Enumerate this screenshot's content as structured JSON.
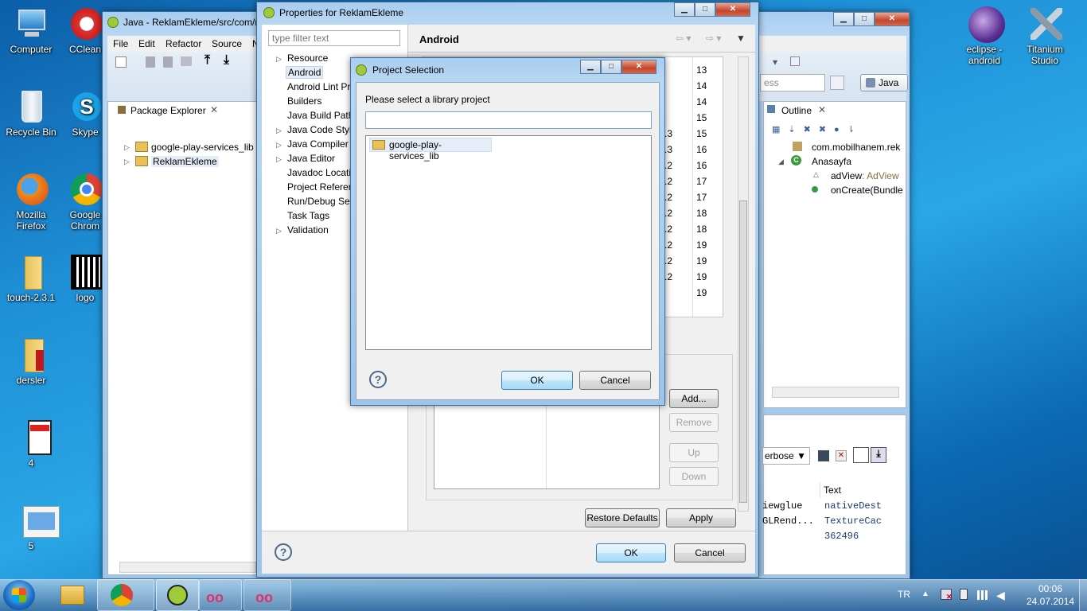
{
  "desktop": {
    "icons": [
      {
        "label": "Computer",
        "icon": "computer-icon"
      },
      {
        "label": "CClean",
        "icon": "ccleaner-icon"
      },
      {
        "label": "Recycle Bin",
        "icon": "recycle-bin-icon"
      },
      {
        "label": "Skype",
        "icon": "skype-icon"
      },
      {
        "label": "Mozilla Firefox",
        "icon": "firefox-icon"
      },
      {
        "label": "Google Chrom",
        "icon": "chrome-icon"
      },
      {
        "label": "touch-2.3.1",
        "icon": "folder-icon"
      },
      {
        "label": "logo",
        "icon": "qr-code-icon"
      },
      {
        "label": "dersler",
        "icon": "folder-icon"
      },
      {
        "label": "4",
        "icon": "image-file-icon"
      },
      {
        "label": "5",
        "icon": "image-file-icon"
      },
      {
        "label": "eclipse - android",
        "icon": "eclipse-icon"
      },
      {
        "label": "Titanium Studio",
        "icon": "titanium-icon"
      }
    ]
  },
  "eclipse": {
    "title": "Java - ReklamEkleme/src/com/m",
    "menu": [
      "File",
      "Edit",
      "Refactor",
      "Source",
      "N"
    ],
    "package_explorer": {
      "tab": "Package Explorer",
      "items": [
        "google-play-services_lib",
        "ReklamEkleme"
      ]
    },
    "perspective": "Java",
    "quick_access": "ess",
    "outline": {
      "tab": "Outline",
      "items": [
        "com.mobilhanem.rek",
        "Anasayfa",
        "adView",
        ": AdView",
        "onCreate(Bundle"
      ]
    },
    "logcat": {
      "level": "erbose",
      "header_text": "Text",
      "rows": [
        {
          "tag": "iewglue",
          "text": "nativeDest"
        },
        {
          "tag": "GLRend...",
          "text": "TextureCac"
        },
        {
          "tag": "",
          "text": "362496"
        }
      ]
    }
  },
  "properties": {
    "title": "Properties for ReklamEkleme",
    "filter_placeholder": "type filter text",
    "nav": [
      "Resource",
      "Android",
      "Android Lint Pr",
      "Builders",
      "Java Build Path",
      "Java Code Style",
      "Java Compiler",
      "Java Editor",
      "Javadoc Locati",
      "Project Referen",
      "Run/Debug Set",
      "Task Tags",
      "Validation"
    ],
    "page_title": "Android",
    "api_levels": [
      "13",
      "14",
      "14",
      "15",
      "15",
      "16",
      "16",
      "17",
      "17",
      "18",
      "18",
      "19",
      "19",
      "19",
      "19"
    ],
    "peek_col": [
      ".3",
      ".3",
      ".2",
      ".2",
      ".2",
      ".2",
      ".2",
      ".2",
      ".2",
      ".2"
    ],
    "library_buttons": {
      "add": "Add...",
      "remove": "Remove",
      "up": "Up",
      "down": "Down"
    },
    "restore_defaults": "Restore Defaults",
    "apply": "Apply",
    "ok": "OK",
    "cancel": "Cancel"
  },
  "project_selection": {
    "title": "Project Selection",
    "prompt": "Please select a library project",
    "filter_value": "",
    "projects": [
      "google-play-services_lib"
    ],
    "ok": "OK",
    "cancel": "Cancel"
  },
  "taskbar": {
    "lang": "TR",
    "time": "00:06",
    "date": "24.07.2014"
  }
}
